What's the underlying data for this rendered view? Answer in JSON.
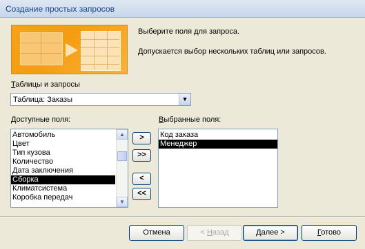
{
  "window": {
    "title": "Создание простых запросов"
  },
  "intro": {
    "line1": "Выберите поля для запроса.",
    "line2": "Допускается выбор нескольких таблиц или запросов."
  },
  "source": {
    "label_ul": "Т",
    "label_rest": "аблицы и запросы",
    "selected": "Таблица: Заказы"
  },
  "available": {
    "label_ul": "Д",
    "label_rest": "оступные поля:",
    "items": [
      "Автомобиль",
      "Цвет",
      "Тип кузова",
      "Количество",
      "Дата заключения",
      "Сборка",
      "Климатсистема",
      "Коробка передач"
    ],
    "selected_index": 5
  },
  "selected_fields": {
    "label_ul": "В",
    "label_rest": "ыбранные поля:",
    "items": [
      "Код заказа",
      "Менеджер"
    ],
    "selected_index": 1
  },
  "move_buttons": {
    "add_one": ">",
    "add_all": ">>",
    "remove_one": "<",
    "remove_all": "<<"
  },
  "footer": {
    "cancel": "Отмена",
    "back_prefix": "< ",
    "back_ul": "Н",
    "back_rest": "азад",
    "next_ul": "Д",
    "next_rest": "алее >",
    "finish_ul": "Г",
    "finish_rest": "отово"
  }
}
